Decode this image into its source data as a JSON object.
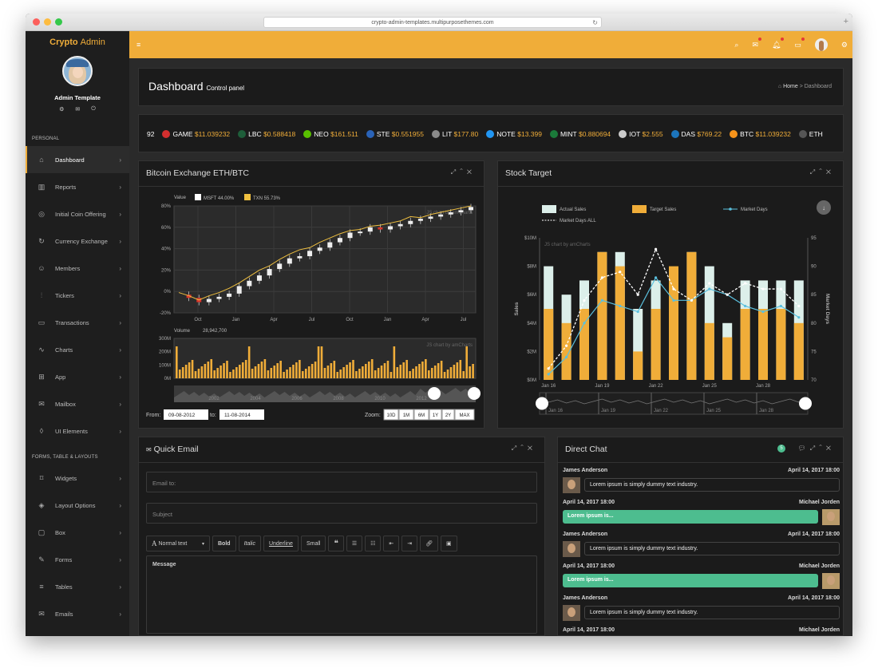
{
  "browser": {
    "url": "crypto-admin-templates.multipurposethemes.com"
  },
  "brand": {
    "name_bold": "Crypto",
    "name_light": "Admin"
  },
  "user": {
    "name": "Admin Template"
  },
  "sidebar": {
    "section_personal": "PERSONAL",
    "section_forms": "FORMS, TABLE & LAYOUTS",
    "items": [
      {
        "label": "Dashboard",
        "icon": "home-icon"
      },
      {
        "label": "Reports",
        "icon": "bar-chart-icon"
      },
      {
        "label": "Initial Coin Offering",
        "icon": "compass-icon"
      },
      {
        "label": "Currency Exchange",
        "icon": "refresh-icon"
      },
      {
        "label": "Members",
        "icon": "users-icon"
      },
      {
        "label": "Tickers",
        "icon": "sliders-icon"
      },
      {
        "label": "Transactions",
        "icon": "folder-icon"
      },
      {
        "label": "Charts",
        "icon": "trend-icon"
      },
      {
        "label": "App",
        "icon": "grid-icon"
      },
      {
        "label": "Mailbox",
        "icon": "mail-icon"
      },
      {
        "label": "UI Elements",
        "icon": "drop-icon"
      }
    ],
    "items2": [
      {
        "label": "Widgets",
        "icon": "tag-icon"
      },
      {
        "label": "Layout Options",
        "icon": "layers-icon"
      },
      {
        "label": "Box",
        "icon": "monitor-icon"
      },
      {
        "label": "Forms",
        "icon": "edit-icon"
      },
      {
        "label": "Tables",
        "icon": "list-icon"
      },
      {
        "label": "Emails",
        "icon": "envelope-open-icon"
      }
    ]
  },
  "header": {
    "title": "Dashboard",
    "subtitle": "Control panel",
    "crumb_home": "Home",
    "crumb_sep": ">",
    "crumb_current": "Dashboard"
  },
  "ticker": [
    {
      "sym": "92",
      "price": "",
      "color": ""
    },
    {
      "sym": "GAME",
      "price": "$11.039232",
      "color": "#d32f2f"
    },
    {
      "sym": "LBC",
      "price": "$0.588418",
      "color": "#1e5e3a"
    },
    {
      "sym": "NEO",
      "price": "$161.511",
      "color": "#58bf00"
    },
    {
      "sym": "STE",
      "price": "$0.551955",
      "color": "#2a63b8"
    },
    {
      "sym": "LIT",
      "price": "$177.80",
      "color": "#8a8a8a"
    },
    {
      "sym": "NOTE",
      "price": "$13.399",
      "color": "#2196f3"
    },
    {
      "sym": "MINT",
      "price": "$0.880694",
      "color": "#1b7a3a"
    },
    {
      "sym": "IOT",
      "price": "$2.555",
      "color": "#cccccc"
    },
    {
      "sym": "DAS",
      "price": "$769.22",
      "color": "#1c75bc"
    },
    {
      "sym": "BTC",
      "price": "$11.039232",
      "color": "#f7931a"
    },
    {
      "sym": "ETH",
      "price": "",
      "color": "#555555"
    }
  ],
  "btc_panel": {
    "title": "Bitcoin Exchange ETH/BTC",
    "from_label": "From:",
    "from_value": "09-08-2012",
    "to_label": "to:",
    "to_value": "11-08-2014",
    "zoom_label": "Zoom:",
    "zoom_options": [
      "10D",
      "1M",
      "6M",
      "1Y",
      "2Y",
      "MAX"
    ]
  },
  "stock_panel": {
    "title": "Stock Target"
  },
  "email_panel": {
    "title": "Quick Email",
    "email_placeholder": "Email to:",
    "subject_placeholder": "Subject",
    "toolbar": {
      "normal_text": "Normal text",
      "bold": "Bold",
      "italic": "Italic",
      "underline": "Underline",
      "small": "Small"
    },
    "message_placeholder": "Message"
  },
  "chat_panel": {
    "title": "Direct Chat",
    "badge": "5",
    "messages": [
      {
        "name": "James Anderson",
        "time": "April 14, 2017 18:00",
        "text": "Lorem ipsum is simply dummy text industry.",
        "side": "in"
      },
      {
        "name": "Michael Jorden",
        "time": "April 14, 2017 18:00",
        "text": "Lorem ipsum is...",
        "side": "out"
      },
      {
        "name": "James Anderson",
        "time": "April 14, 2017 18:00",
        "text": "Lorem ipsum is simply dummy text industry.",
        "side": "in"
      },
      {
        "name": "Michael Jorden",
        "time": "April 14, 2017 18:00",
        "text": "Lorem ipsum is...",
        "side": "out"
      },
      {
        "name": "James Anderson",
        "time": "April 14, 2017 18:00",
        "text": "Lorem ipsum is simply dummy text industry.",
        "side": "in"
      },
      {
        "name": "Michael Jorden",
        "time": "April 14, 2017 18:00",
        "text": "",
        "side": "out"
      }
    ]
  },
  "chart_data": [
    {
      "type": "line",
      "legend_header": "Value",
      "series": [
        {
          "name": "MSFT 44.00%",
          "color": "#ffffff",
          "values": [
            -3,
            -6,
            -10,
            -7,
            -5,
            -2,
            5,
            10,
            15,
            21,
            26,
            31,
            33,
            38,
            41,
            46,
            50,
            55,
            56,
            60,
            58,
            61,
            63,
            66,
            68,
            70,
            72,
            74,
            76,
            79
          ]
        },
        {
          "name": "TXN 55.73%",
          "color": "#f0c040",
          "values": [
            -1,
            -4,
            -8,
            -4,
            -1,
            3,
            8,
            14,
            20,
            24,
            30,
            35,
            39,
            41,
            46,
            50,
            54,
            57,
            58,
            61,
            62,
            64,
            66,
            70,
            69,
            72,
            74,
            76,
            78,
            80
          ]
        }
      ],
      "x_ticks": [
        "Oct",
        "Jan",
        "Apr",
        "Jul",
        "Oct",
        "Jan",
        "Apr",
        "Jul"
      ],
      "y_ticks": [
        "80%",
        "60%",
        "40%",
        "20%",
        "0%",
        "-20%"
      ],
      "watermark": "JS chart by amCharts",
      "volume": {
        "label": "Volume",
        "value": "28,942,700",
        "y_ticks": [
          "300M",
          "200M",
          "100M",
          "0M"
        ]
      },
      "navigator_ticks": [
        "2002",
        "2004",
        "2006",
        "2008",
        "2010",
        "2012"
      ]
    },
    {
      "type": "bar",
      "legend": [
        "Actual Sales",
        "Target Sales",
        "Market Days",
        "Market Days ALL"
      ],
      "categories": [
        "Jan 16",
        "",
        "",
        "Jan 19",
        "",
        "",
        "Jan 22",
        "",
        "",
        "Jan 25",
        "",
        "",
        "Jan 28",
        "",
        ""
      ],
      "series": [
        {
          "name": "Actual Sales",
          "color": "#dcefea",
          "values": [
            8,
            6,
            7,
            9,
            9,
            5,
            7,
            6,
            9,
            8,
            4,
            7,
            7,
            7,
            7
          ]
        },
        {
          "name": "Target Sales",
          "color": "#f0ad39",
          "values": [
            5,
            4,
            5,
            9,
            8,
            2,
            5,
            8,
            9,
            4,
            3,
            5,
            5,
            5,
            4
          ]
        },
        {
          "name": "Market Days",
          "color": "#5bc0de",
          "values": [
            71,
            74,
            80,
            84,
            83,
            82,
            88,
            84,
            84,
            86,
            85,
            83,
            82,
            83,
            81
          ]
        },
        {
          "name": "Market Days ALL",
          "color": "#ffffff",
          "values": [
            72,
            76,
            84,
            88,
            89,
            85,
            93,
            86,
            84,
            87,
            85,
            87,
            86,
            86,
            83
          ]
        }
      ],
      "y_ticks": [
        "$10M",
        "$8M",
        "$6M",
        "$4M",
        "$2M",
        "$0M"
      ],
      "y2_ticks": [
        "95",
        "90",
        "85",
        "80",
        "75",
        "70"
      ],
      "ylabel": "Sales",
      "y2label": "Market Days",
      "ylim": [
        0,
        10
      ],
      "y2lim": [
        70,
        95
      ],
      "watermark": "JS chart by amCharts",
      "navigator_ticks": [
        "Jan 16",
        "Jan 19",
        "Jan 22",
        "Jan 25",
        "Jan 28"
      ]
    }
  ]
}
